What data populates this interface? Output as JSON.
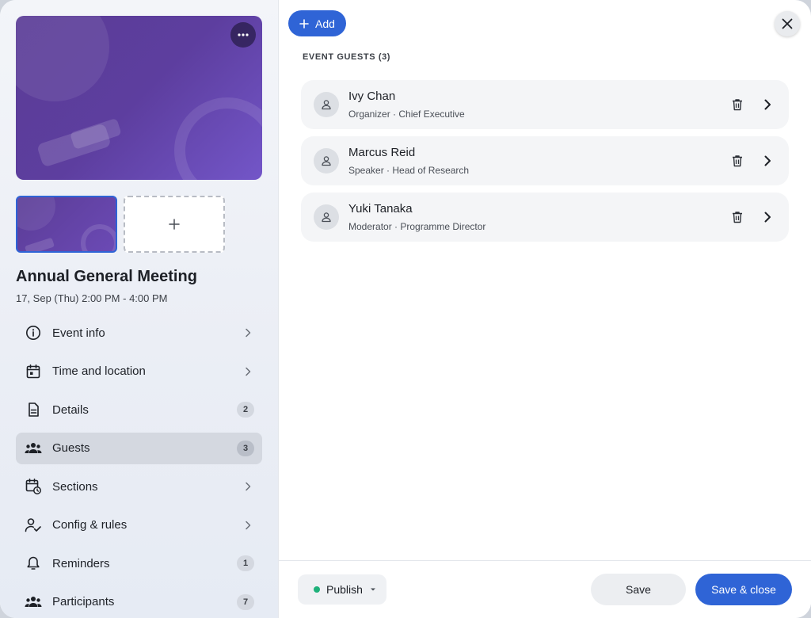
{
  "event": {
    "title": "Annual General Meeting",
    "datetime": "17, Sep (Thu) 2:00 PM - 4:00 PM"
  },
  "cover": {
    "menu_icon": "more-horizontal-icon"
  },
  "thumbnails": {
    "add_icon": "plus-icon"
  },
  "nav": [
    {
      "label": "Event info",
      "icon": "info-circle-icon",
      "badge": null
    },
    {
      "label": "Time and location",
      "icon": "calendar-icon",
      "badge": null
    },
    {
      "label": "Details",
      "icon": "document-icon",
      "badge": "2"
    },
    {
      "label": "Guests",
      "icon": "group-icon",
      "badge": "3",
      "active": true
    },
    {
      "label": "Sections",
      "icon": "calendar-clock-icon",
      "badge": null
    },
    {
      "label": "Config & rules",
      "icon": "user-check-icon",
      "badge": null
    },
    {
      "label": "Reminders",
      "icon": "bell-icon",
      "badge": "1"
    },
    {
      "label": "Participants",
      "icon": "group-icon",
      "badge": "7"
    }
  ],
  "toolbar": {
    "add_label": "Add"
  },
  "section": {
    "label": "EVENT GUESTS (3)"
  },
  "guests": [
    {
      "name": "Ivy Chan",
      "role": "Organizer · Chief Executive"
    },
    {
      "name": "Marcus Reid",
      "role": "Speaker · Head of Research"
    },
    {
      "name": "Yuki Tanaka",
      "role": "Moderator · Programme Director"
    }
  ],
  "footer": {
    "publish_label": "Publish",
    "save_label": "Save",
    "save_close_label": "Save & close"
  },
  "colors": {
    "accent": "#2f64d6",
    "status_dot": "#1fb17a",
    "cover_purple": "#5d3e9f"
  }
}
